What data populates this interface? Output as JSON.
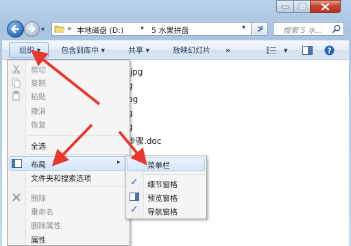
{
  "window": {
    "colors": {
      "frame": "#b9d1ea",
      "close": "#c7462f",
      "accent": "#2b67b4",
      "arrow": "#e8372b"
    }
  },
  "nav": {
    "path_chevron": "«",
    "breadcrumb": [
      "本地磁盘 (D:)",
      "5 水果拼盘"
    ],
    "breadcrumb_sep": "▸",
    "search_placeholder": "搜索 5 水...",
    "search_icon": "magnifier-icon",
    "dropdown_glyph": "▾",
    "refresh_glyph": "⁴ʸ"
  },
  "toolbar": {
    "organize": "组织 ▾",
    "include_library": "包含到库中 ▾",
    "share": "共享 ▾",
    "slideshow": "放映幻灯片",
    "more": "»",
    "view_menu": "▾",
    "help": "?"
  },
  "files": [
    ".jpg",
    "g",
    "pg",
    "g",
    "g",
    "步骤.doc"
  ],
  "organize_menu": {
    "items": [
      {
        "label": "剪切",
        "disabled": true
      },
      {
        "label": "复制",
        "disabled": true
      },
      {
        "label": "粘贴",
        "disabled": true
      },
      {
        "label": "撤消",
        "disabled": true
      },
      {
        "label": "恢复",
        "disabled": true
      },
      {
        "label": "全选",
        "disabled": false
      },
      {
        "label": "布局",
        "disabled": false,
        "has_submenu": true
      },
      {
        "label": "文件夹和搜索选项",
        "disabled": false
      },
      {
        "label": "删除",
        "disabled": true
      },
      {
        "label": "重命名",
        "disabled": true
      },
      {
        "label": "删除属性",
        "disabled": true
      },
      {
        "label": "属性",
        "disabled": false
      }
    ],
    "submenu_arrow": "▸"
  },
  "layout_submenu": {
    "items": [
      {
        "label": "菜单栏",
        "checked": false
      },
      {
        "label": "细节窗格",
        "checked": true
      },
      {
        "label": "预览窗格",
        "checked": false
      },
      {
        "label": "导航窗格",
        "checked": true
      }
    ],
    "check_glyph": "✓"
  }
}
